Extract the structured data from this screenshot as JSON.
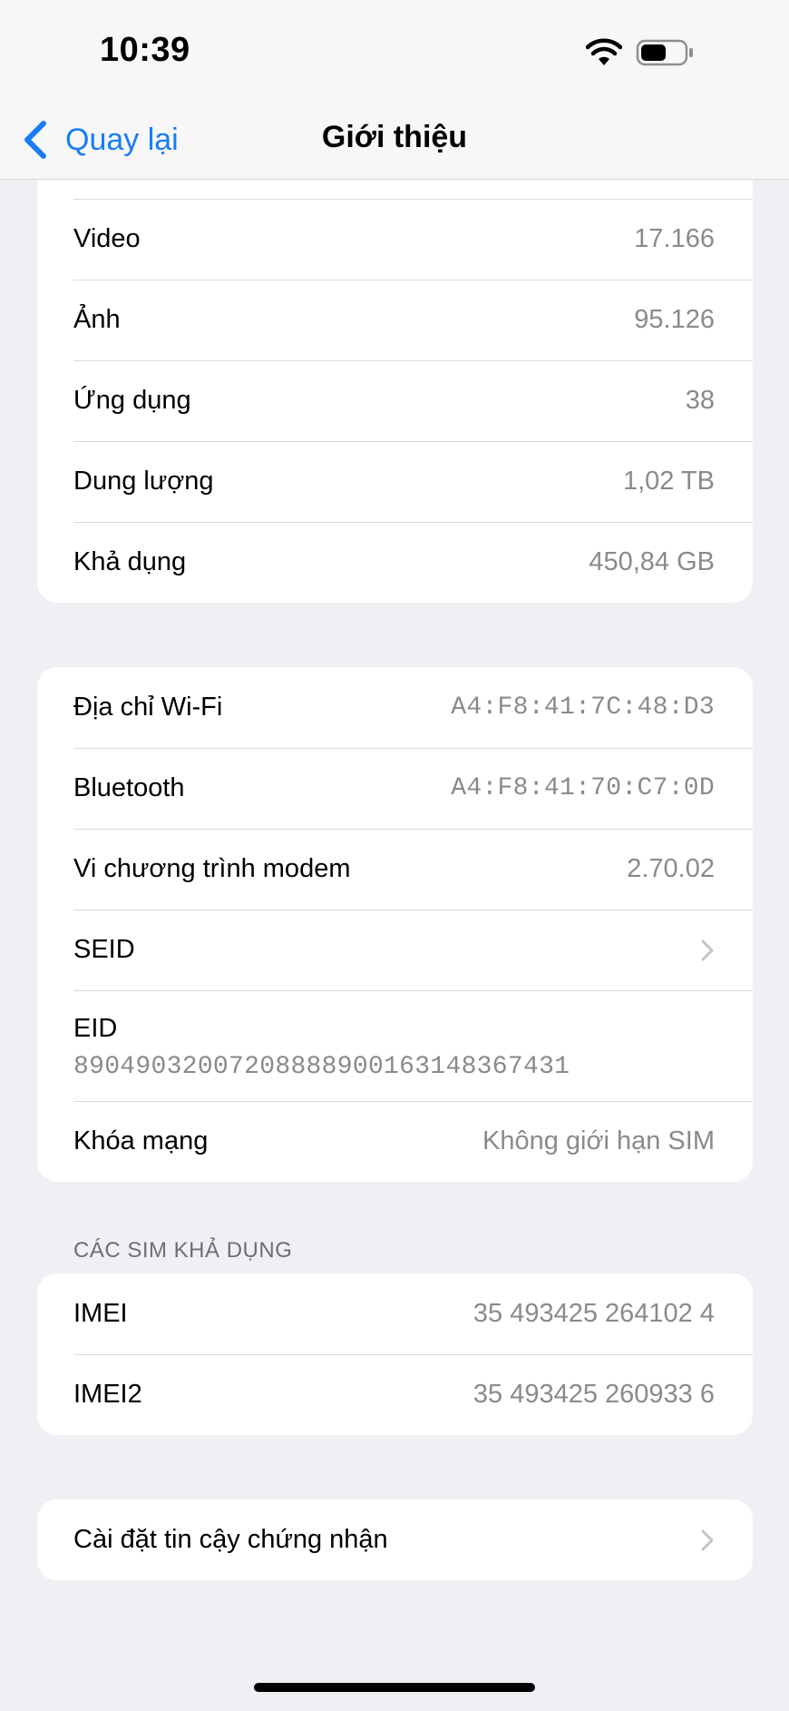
{
  "status_bar": {
    "time": "10:39"
  },
  "nav": {
    "back_label": "Quay lại",
    "title": "Giới thiệu"
  },
  "group_storage": [
    {
      "label": "Video",
      "value": "17.166"
    },
    {
      "label": "Ảnh",
      "value": "95.126"
    },
    {
      "label": "Ứng dụng",
      "value": "38"
    },
    {
      "label": "Dung lượng",
      "value": "1,02 TB"
    },
    {
      "label": "Khả dụng",
      "value": "450,84 GB"
    }
  ],
  "group_network": {
    "wifi": {
      "label": "Địa chỉ Wi-Fi",
      "value": "A4:F8:41:7C:48:D3"
    },
    "bluetooth": {
      "label": "Bluetooth",
      "value": "A4:F8:41:70:C7:0D"
    },
    "modem": {
      "label": "Vi chương trình modem",
      "value": "2.70.02"
    },
    "seid": {
      "label": "SEID"
    },
    "eid": {
      "label": "EID",
      "value": "89049032007208888900163148367431"
    },
    "carrier_lock": {
      "label": "Khóa mạng",
      "value": "Không giới hạn SIM"
    }
  },
  "sim_section": {
    "header": "CÁC SIM KHẢ DỤNG",
    "imei": {
      "label": "IMEI",
      "value": "35 493425 264102 4"
    },
    "imei2": {
      "label": "IMEI2",
      "value": "35 493425 260933 6"
    }
  },
  "certificate": {
    "label": "Cài đặt tin cậy chứng nhận"
  },
  "colors": {
    "accent": "#1a7cf5",
    "secondary_text": "#8a8a8e",
    "background": "#efeff4"
  },
  "icons": [
    "chevron-left-icon",
    "wifi-icon",
    "battery-icon",
    "chevron-right-icon"
  ]
}
